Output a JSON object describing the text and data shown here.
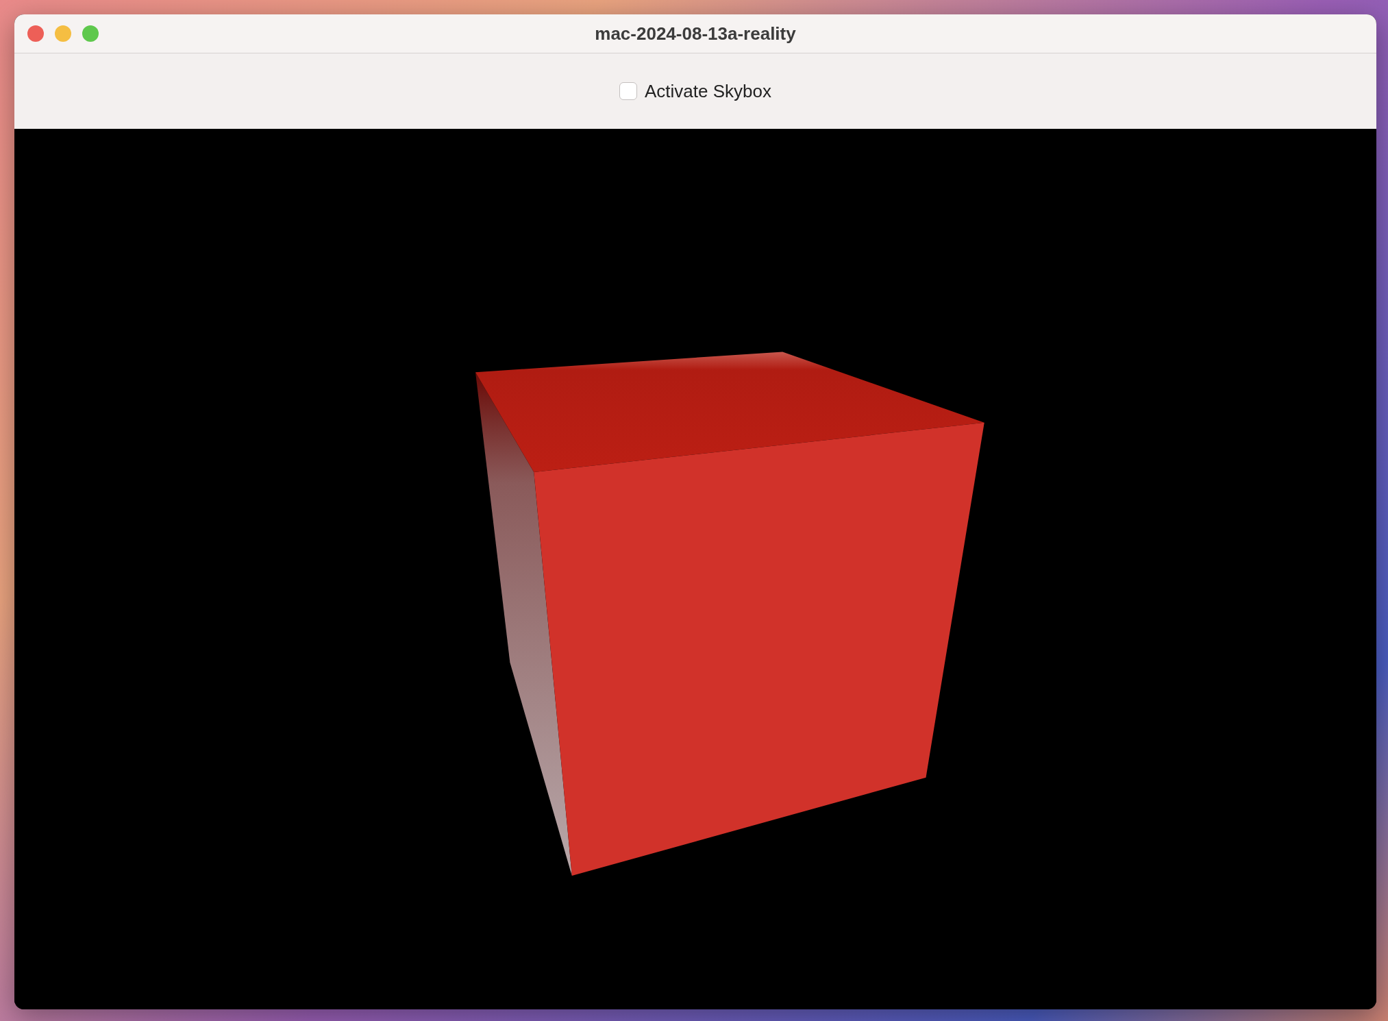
{
  "window": {
    "title": "mac-2024-08-13a-reality"
  },
  "toolbar": {
    "checkbox": {
      "label": "Activate Skybox",
      "checked": false
    }
  },
  "viewport": {
    "kind": "scene"
  }
}
